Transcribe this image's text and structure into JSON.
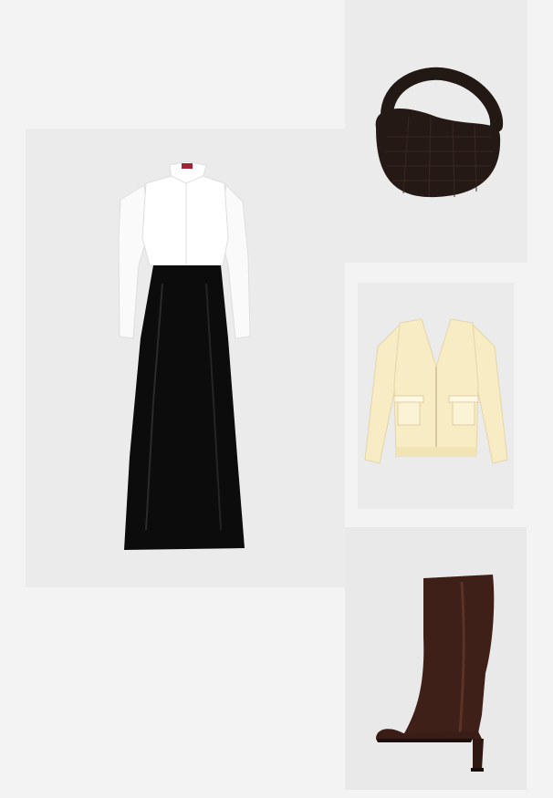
{
  "board": {
    "background_color": "#f3f3f3",
    "items": [
      {
        "name": "shirt-dress",
        "description_color": "#ffffff",
        "tile_color": "#ebebeb"
      },
      {
        "name": "woven-hobo-bag",
        "description_color": "#2a1d18",
        "tile_color": "#ebebeb"
      },
      {
        "name": "cardigan",
        "description_color": "#f8ecc4",
        "tile_color": "#ebebeb"
      },
      {
        "name": "knee-boot",
        "description_color": "#3e2019",
        "tile_color": "#e9e9e9"
      }
    ]
  }
}
